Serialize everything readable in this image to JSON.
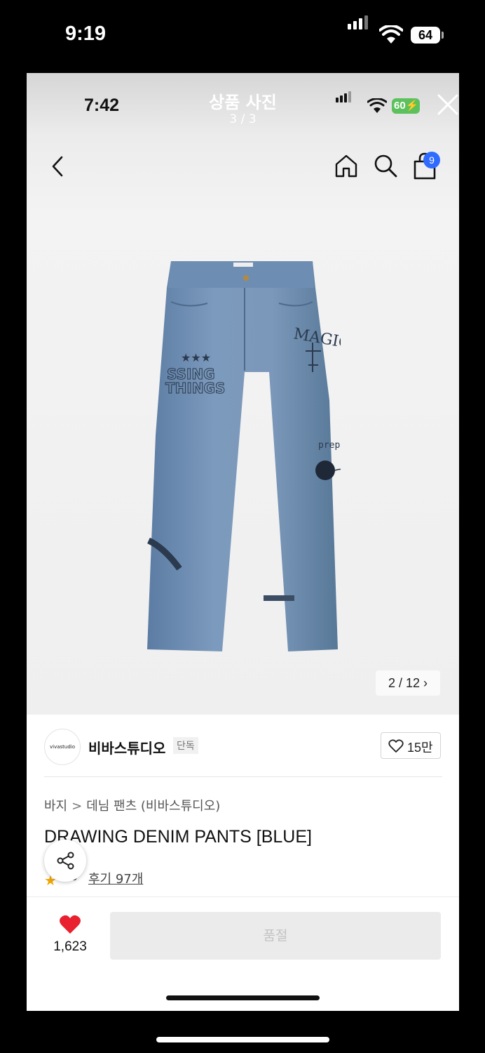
{
  "device": {
    "time": "9:19",
    "battery": "64"
  },
  "viewer": {
    "title": "상품 사진",
    "count": "3 / 3"
  },
  "inner_status": {
    "time": "7:42",
    "battery": "60"
  },
  "nav": {
    "cart_badge": "9"
  },
  "photo": {
    "pager": "2 / 12 ›"
  },
  "brand": {
    "logo_text": "vivastudio",
    "name": "비바스튜디오",
    "tag": "단독",
    "likes": "15만"
  },
  "product": {
    "category": [
      "바지",
      "데님 팬츠 (비바스튜디오)"
    ],
    "category_sep": ">",
    "title": "DRAWING DENIM PANTS [BLUE]",
    "rating": ".9",
    "reviews": "후기 97개"
  },
  "actions": {
    "heart_count": "1,623",
    "buy_label": "품절"
  },
  "colors": {
    "accent_blue": "#2f6bff",
    "heart_red": "#e8202f",
    "star": "#f0a500",
    "battery_green": "#5cc15c"
  },
  "icons": [
    "back-icon",
    "home-icon",
    "search-icon",
    "bag-icon",
    "close-icon",
    "heart-icon",
    "share-icon",
    "star-icon"
  ]
}
